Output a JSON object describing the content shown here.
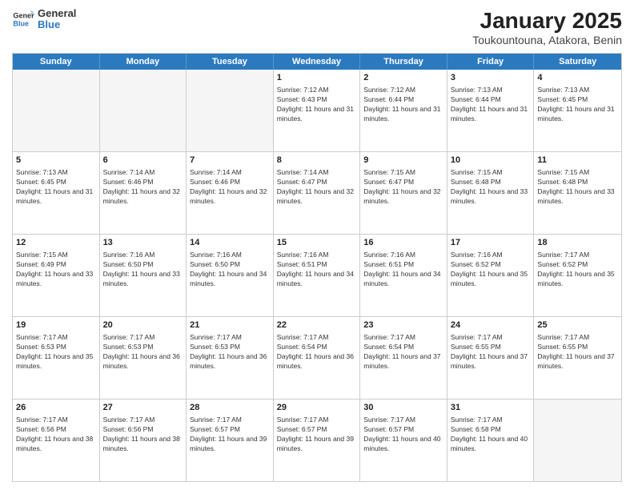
{
  "logo": {
    "line1": "General",
    "line2": "Blue"
  },
  "title": "January 2025",
  "subtitle": "Toukountouna, Atakora, Benin",
  "weekdays": [
    "Sunday",
    "Monday",
    "Tuesday",
    "Wednesday",
    "Thursday",
    "Friday",
    "Saturday"
  ],
  "rows": [
    [
      {
        "day": "",
        "empty": true
      },
      {
        "day": "",
        "empty": true
      },
      {
        "day": "",
        "empty": true
      },
      {
        "day": "1",
        "sr": "7:12 AM",
        "ss": "6:43 PM",
        "dl": "11 hours and 31 minutes."
      },
      {
        "day": "2",
        "sr": "7:12 AM",
        "ss": "6:44 PM",
        "dl": "11 hours and 31 minutes."
      },
      {
        "day": "3",
        "sr": "7:13 AM",
        "ss": "6:44 PM",
        "dl": "11 hours and 31 minutes."
      },
      {
        "day": "4",
        "sr": "7:13 AM",
        "ss": "6:45 PM",
        "dl": "11 hours and 31 minutes."
      }
    ],
    [
      {
        "day": "5",
        "sr": "7:13 AM",
        "ss": "6:45 PM",
        "dl": "11 hours and 31 minutes."
      },
      {
        "day": "6",
        "sr": "7:14 AM",
        "ss": "6:46 PM",
        "dl": "11 hours and 32 minutes."
      },
      {
        "day": "7",
        "sr": "7:14 AM",
        "ss": "6:46 PM",
        "dl": "11 hours and 32 minutes."
      },
      {
        "day": "8",
        "sr": "7:14 AM",
        "ss": "6:47 PM",
        "dl": "11 hours and 32 minutes."
      },
      {
        "day": "9",
        "sr": "7:15 AM",
        "ss": "6:47 PM",
        "dl": "11 hours and 32 minutes."
      },
      {
        "day": "10",
        "sr": "7:15 AM",
        "ss": "6:48 PM",
        "dl": "11 hours and 33 minutes."
      },
      {
        "day": "11",
        "sr": "7:15 AM",
        "ss": "6:48 PM",
        "dl": "11 hours and 33 minutes."
      }
    ],
    [
      {
        "day": "12",
        "sr": "7:15 AM",
        "ss": "6:49 PM",
        "dl": "11 hours and 33 minutes."
      },
      {
        "day": "13",
        "sr": "7:16 AM",
        "ss": "6:50 PM",
        "dl": "11 hours and 33 minutes."
      },
      {
        "day": "14",
        "sr": "7:16 AM",
        "ss": "6:50 PM",
        "dl": "11 hours and 34 minutes."
      },
      {
        "day": "15",
        "sr": "7:16 AM",
        "ss": "6:51 PM",
        "dl": "11 hours and 34 minutes."
      },
      {
        "day": "16",
        "sr": "7:16 AM",
        "ss": "6:51 PM",
        "dl": "11 hours and 34 minutes."
      },
      {
        "day": "17",
        "sr": "7:16 AM",
        "ss": "6:52 PM",
        "dl": "11 hours and 35 minutes."
      },
      {
        "day": "18",
        "sr": "7:17 AM",
        "ss": "6:52 PM",
        "dl": "11 hours and 35 minutes."
      }
    ],
    [
      {
        "day": "19",
        "sr": "7:17 AM",
        "ss": "6:53 PM",
        "dl": "11 hours and 35 minutes."
      },
      {
        "day": "20",
        "sr": "7:17 AM",
        "ss": "6:53 PM",
        "dl": "11 hours and 36 minutes."
      },
      {
        "day": "21",
        "sr": "7:17 AM",
        "ss": "6:53 PM",
        "dl": "11 hours and 36 minutes."
      },
      {
        "day": "22",
        "sr": "7:17 AM",
        "ss": "6:54 PM",
        "dl": "11 hours and 36 minutes."
      },
      {
        "day": "23",
        "sr": "7:17 AM",
        "ss": "6:54 PM",
        "dl": "11 hours and 37 minutes."
      },
      {
        "day": "24",
        "sr": "7:17 AM",
        "ss": "6:55 PM",
        "dl": "11 hours and 37 minutes."
      },
      {
        "day": "25",
        "sr": "7:17 AM",
        "ss": "6:55 PM",
        "dl": "11 hours and 37 minutes."
      }
    ],
    [
      {
        "day": "26",
        "sr": "7:17 AM",
        "ss": "6:56 PM",
        "dl": "11 hours and 38 minutes."
      },
      {
        "day": "27",
        "sr": "7:17 AM",
        "ss": "6:56 PM",
        "dl": "11 hours and 38 minutes."
      },
      {
        "day": "28",
        "sr": "7:17 AM",
        "ss": "6:57 PM",
        "dl": "11 hours and 39 minutes."
      },
      {
        "day": "29",
        "sr": "7:17 AM",
        "ss": "6:57 PM",
        "dl": "11 hours and 39 minutes."
      },
      {
        "day": "30",
        "sr": "7:17 AM",
        "ss": "6:57 PM",
        "dl": "11 hours and 40 minutes."
      },
      {
        "day": "31",
        "sr": "7:17 AM",
        "ss": "6:58 PM",
        "dl": "11 hours and 40 minutes."
      },
      {
        "day": "",
        "empty": true
      }
    ]
  ],
  "labels": {
    "sunrise": "Sunrise:",
    "sunset": "Sunset:",
    "daylight": "Daylight:"
  }
}
